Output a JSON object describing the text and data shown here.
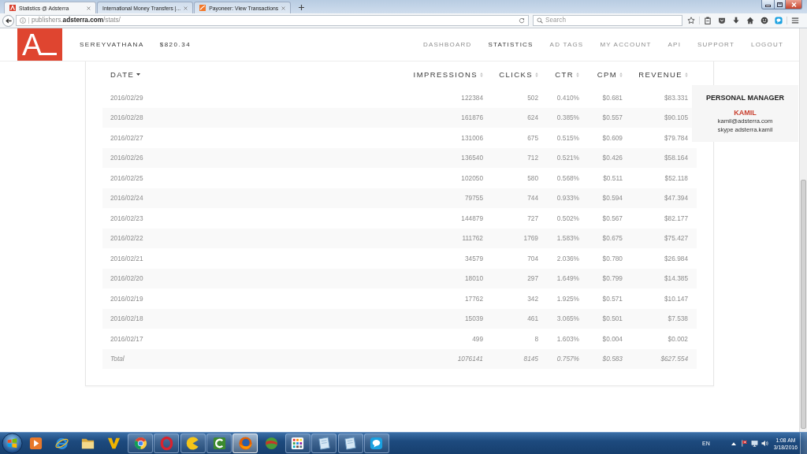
{
  "browser": {
    "tabs": [
      {
        "title": "Statistics @ Adsterra",
        "selected": true
      },
      {
        "title": "International Money Transfers |...",
        "selected": false
      },
      {
        "title": "Payoneer: View Transactions",
        "selected": false
      }
    ],
    "address": "publishers.**adsterra.com**/stats/",
    "search": {
      "placeholder": "Search"
    }
  },
  "site": {
    "logo": "A",
    "username": "SEREYVATHANA",
    "balance": "$820.34",
    "nav": [
      {
        "label": "DASHBOARD",
        "selected": false
      },
      {
        "label": "STATISTICS",
        "selected": true
      },
      {
        "label": "AD TAGS",
        "selected": false
      },
      {
        "label": "MY ACCOUNT",
        "selected": false
      },
      {
        "label": "API",
        "selected": false
      },
      {
        "label": "SUPPORT",
        "selected": false
      },
      {
        "label": "LOGOUT",
        "selected": false
      }
    ]
  },
  "table": {
    "columns": [
      {
        "label": "DATE",
        "sorted": true
      },
      {
        "label": "IMPRESSIONS",
        "sorted": false
      },
      {
        "label": "CLICKS",
        "sorted": false
      },
      {
        "label": "CTR",
        "sorted": false
      },
      {
        "label": "CPM",
        "sorted": false
      },
      {
        "label": "REVENUE",
        "sorted": false
      }
    ],
    "rows": [
      [
        "2016/02/29",
        "122384",
        "502",
        "0.410%",
        "$0.681",
        "$83.331"
      ],
      [
        "2016/02/28",
        "161876",
        "624",
        "0.385%",
        "$0.557",
        "$90.105"
      ],
      [
        "2016/02/27",
        "131006",
        "675",
        "0.515%",
        "$0.609",
        "$79.784"
      ],
      [
        "2016/02/26",
        "136540",
        "712",
        "0.521%",
        "$0.426",
        "$58.164"
      ],
      [
        "2016/02/25",
        "102050",
        "580",
        "0.568%",
        "$0.511",
        "$52.118"
      ],
      [
        "2016/02/24",
        "79755",
        "744",
        "0.933%",
        "$0.594",
        "$47.394"
      ],
      [
        "2016/02/23",
        "144879",
        "727",
        "0.502%",
        "$0.567",
        "$82.177"
      ],
      [
        "2016/02/22",
        "111762",
        "1769",
        "1.583%",
        "$0.675",
        "$75.427"
      ],
      [
        "2016/02/21",
        "34579",
        "704",
        "2.036%",
        "$0.780",
        "$26.984"
      ],
      [
        "2016/02/20",
        "18010",
        "297",
        "1.649%",
        "$0.799",
        "$14.385"
      ],
      [
        "2016/02/19",
        "17762",
        "342",
        "1.925%",
        "$0.571",
        "$10.147"
      ],
      [
        "2016/02/18",
        "15039",
        "461",
        "3.065%",
        "$0.501",
        "$7.538"
      ],
      [
        "2016/02/17",
        "499",
        "8",
        "1.603%",
        "$0.004",
        "$0.002"
      ]
    ],
    "total": [
      "Total",
      "1076141",
      "8145",
      "0.757%",
      "$0.583",
      "$627.554"
    ]
  },
  "manager": {
    "title": "PERSONAL MANAGER",
    "name": "KAMIL",
    "email": "kamil@adsterra.com",
    "skype": "skype adsterra.kamil"
  },
  "taskbar": {
    "apps": [
      {
        "running": false,
        "selected": false
      },
      {
        "running": false,
        "selected": false
      },
      {
        "running": false,
        "selected": false
      },
      {
        "running": false,
        "selected": false
      },
      {
        "running": true,
        "selected": false
      },
      {
        "running": true,
        "selected": false
      },
      {
        "running": true,
        "selected": false
      },
      {
        "running": true,
        "selected": false
      },
      {
        "running": true,
        "selected": true
      },
      {
        "running": false,
        "selected": false
      },
      {
        "running": true,
        "selected": false
      },
      {
        "running": true,
        "selected": false
      },
      {
        "running": true,
        "selected": false
      },
      {
        "running": true,
        "selected": false
      }
    ],
    "language": "EN",
    "time": "1:08 AM",
    "date": "3/18/2016"
  }
}
